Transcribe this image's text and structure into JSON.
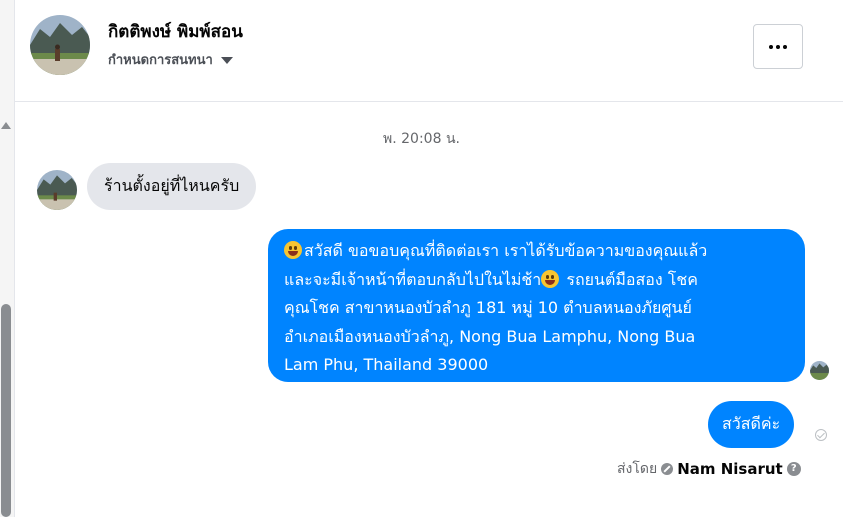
{
  "header": {
    "contact_name": "กิตติพงษ์ พิมพ์สอน",
    "subtitle": "กำหนดการสนทนา",
    "more_icon": "more-horizontal-icon"
  },
  "conversation": {
    "timestamp": "พ. 20:08 น.",
    "incoming_message": "ร้านตั้งอยู่ที่ไหนครับ",
    "auto_reply_lines": [
      "สวัสดี ขอขอบคุณที่ติดต่อเรา เราได้รับข้อความของคุณแล้ว",
      "และจะมีเจ้าหน้าที่ตอบกลับไปในไม่ช้า",
      " รถยนต์มือสอง โชค",
      "คุณโชค สาขาหนองบัวลำภู 181 หมู่ 10  ตำบลหนองภัยศูนย์",
      "อำเภอเมืองหนองบัวลำภู, Nong Bua Lamphu, Nong Bua",
      "Lam Phu, Thailand 39000"
    ],
    "reply_message": "สวัสดีค่ะ",
    "sent_by_label": "ส่งโดย",
    "sender_name": "Nam Nisarut",
    "help_glyph": "?"
  },
  "colors": {
    "outgoing_bubble": "#0084ff",
    "incoming_bubble": "#e4e6eb",
    "secondary_text": "#65676b"
  }
}
